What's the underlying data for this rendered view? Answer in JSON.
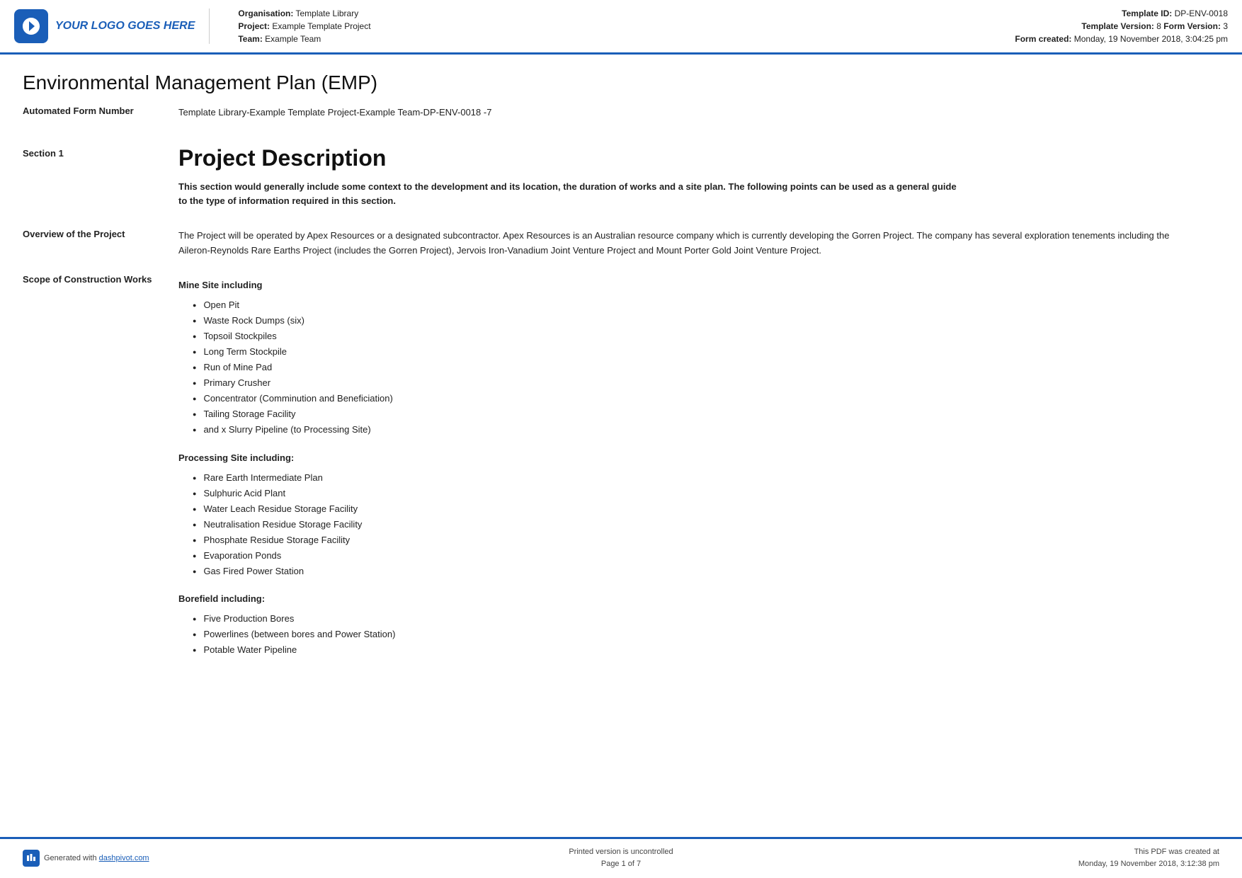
{
  "header": {
    "logo_text": "YOUR LOGO GOES HERE",
    "org_label": "Organisation:",
    "org_value": "Template Library",
    "project_label": "Project:",
    "project_value": "Example Template Project",
    "team_label": "Team:",
    "team_value": "Example Team",
    "template_id_label": "Template ID:",
    "template_id_value": "DP-ENV-0018",
    "template_version_label": "Template Version:",
    "template_version_value": "8",
    "form_version_label": "Form Version:",
    "form_version_value": "3",
    "form_created_label": "Form created:",
    "form_created_value": "Monday, 19 November 2018, 3:04:25 pm"
  },
  "document": {
    "title": "Environmental Management Plan (EMP)",
    "automated_form_label": "Automated Form Number",
    "automated_form_value": "Template Library-Example Template Project-Example Team-DP-ENV-0018   -7"
  },
  "section1": {
    "label": "Section 1",
    "heading": "Project Description",
    "subtext": "This section would generally include some context to the development and its location, the duration of works and a site plan. The following points can be used as a general guide to the type of information required in this section."
  },
  "overview": {
    "label": "Overview of the Project",
    "text": "The Project will be operated by Apex Resources or a designated subcontractor. Apex Resources is an Australian resource company which is currently developing the Gorren Project. The company has several exploration tenements including the Aileron-Reynolds Rare Earths Project (includes the Gorren Project), Jervois Iron-Vanadium Joint Venture Project and Mount Porter Gold Joint Venture Project."
  },
  "scope": {
    "label": "Scope of Construction Works",
    "mine_site_heading": "Mine Site including",
    "mine_site_items": [
      "Open Pit",
      "Waste Rock Dumps (six)",
      "Topsoil Stockpiles",
      "Long Term Stockpile",
      "Run of Mine Pad",
      "Primary Crusher",
      "Concentrator (Comminution and Beneficiation)",
      "Tailing Storage Facility",
      "and x Slurry Pipeline (to Processing Site)"
    ],
    "processing_site_heading": "Processing Site including:",
    "processing_site_items": [
      "Rare Earth Intermediate Plan",
      "Sulphuric Acid Plant",
      "Water Leach Residue Storage Facility",
      "Neutralisation Residue Storage Facility",
      "Phosphate Residue Storage Facility",
      "Evaporation Ponds",
      "Gas Fired Power Station"
    ],
    "borefield_heading": "Borefield including:",
    "borefield_items": [
      "Five Production Bores",
      "Powerlines (between bores and Power Station)",
      "Potable Water Pipeline"
    ]
  },
  "footer": {
    "generated_text": "Generated with",
    "link_text": "dashpivot.com",
    "center_line1": "Printed version is uncontrolled",
    "center_line2": "Page 1 of 7",
    "right_line1": "This PDF was created at",
    "right_line2": "Monday, 19 November 2018, 3:12:38 pm"
  }
}
